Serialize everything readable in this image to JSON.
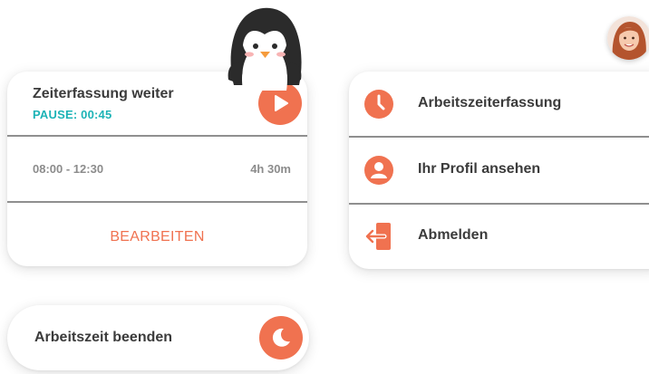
{
  "time_card": {
    "title": "Zeiterfassung weiter",
    "pause": "PAUSE: 00:45",
    "time_range": "08:00 - 12:30",
    "duration": "4h 30m",
    "edit_label": "BEARBEITEN",
    "action_icon": "play-icon"
  },
  "menu": {
    "items": [
      {
        "label": "Arbeitszeiterfassung",
        "icon": "clock-icon"
      },
      {
        "label": "Ihr Profil ansehen",
        "icon": "user-icon"
      },
      {
        "label": "Abmelden",
        "icon": "logout-icon"
      }
    ]
  },
  "end_card": {
    "label": "Arbeitszeit beenden",
    "icon": "moon-icon"
  },
  "decor": {
    "mascot": "penguin",
    "avatar": "user-avatar"
  },
  "colors": {
    "accent": "#f07250",
    "pause": "#1cb3b6",
    "text": "#3b3b3b",
    "muted": "#8c8c8c",
    "divider": "#8f8f8f"
  }
}
